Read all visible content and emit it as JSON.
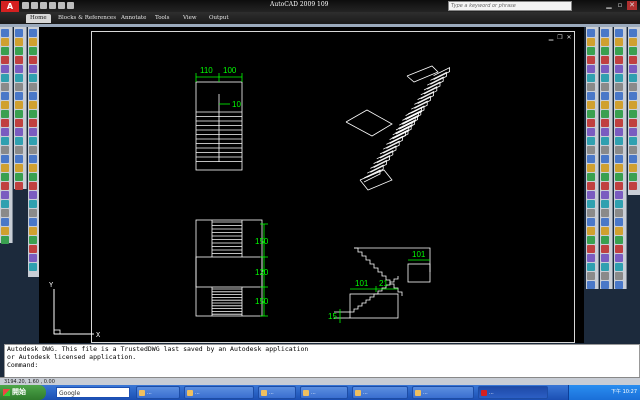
{
  "window": {
    "title": "AutoCAD 2009  109",
    "search_placeholder": "Type a keyword or phrase",
    "logo_letter": "A"
  },
  "ribbon": {
    "tabs": [
      "Home",
      "Blocks & References",
      "Annotate",
      "Tools",
      "View",
      "Output"
    ],
    "active_tab": "Home"
  },
  "drawing": {
    "plan_dims": {
      "left": "110",
      "right": "100",
      "gap": "10"
    },
    "section_dims": {
      "top": "150",
      "middle": "120",
      "bottom": "150"
    },
    "elevation_dims": {
      "tread": "101",
      "landing_left": "101",
      "landing_right": "21",
      "rise": "15"
    },
    "ucs": {
      "x_label": "X",
      "y_label": "Y"
    }
  },
  "command_line": {
    "line1": "Autodesk DWG.  This file is a TrustedDWG last saved by an Autodesk application",
    "line2": "or Autodesk licensed application.",
    "prompt": "Command:"
  },
  "status_bar": {
    "coords": "3194.20, 1.60 , 0.00"
  },
  "taskbar": {
    "start_label": "開始",
    "google_label": "Google",
    "tasks": [
      "...",
      "...",
      "...",
      "...",
      "...",
      "...",
      "..."
    ],
    "clock": "下午 10:27"
  },
  "colors": {
    "canvas": "#000000",
    "dimension": "#00ff00",
    "geometry": "#ffffff",
    "taskbar": "#2558c0"
  }
}
